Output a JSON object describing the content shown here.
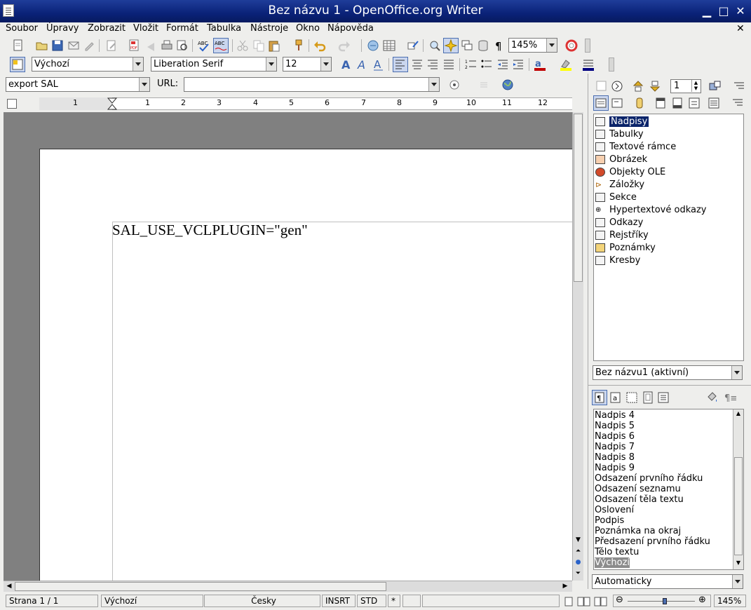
{
  "window": {
    "title": "Bez názvu 1 - OpenOffice.org Writer"
  },
  "menu": {
    "items": [
      "Soubor",
      "Úpravy",
      "Zobrazit",
      "Vložit",
      "Formát",
      "Tabulka",
      "Nástroje",
      "Okno",
      "Nápověda"
    ]
  },
  "toolbar": {
    "zoom": "145%"
  },
  "formatting": {
    "paragraph_style": "Výchozí",
    "font_name": "Liberation Serif",
    "font_size": "12"
  },
  "hyperlink_bar": {
    "target": "export SAL",
    "url_label": "URL:",
    "url_value": ""
  },
  "ruler": {
    "marks": [
      "1",
      "1",
      "2",
      "3",
      "4",
      "5",
      "6",
      "7",
      "8",
      "9",
      "10",
      "11",
      "12"
    ]
  },
  "document": {
    "text": "SAL_USE_VCLPLUGIN=\"gen\""
  },
  "navigator": {
    "page_number": "1",
    "categories": [
      "Nadpisy",
      "Tabulky",
      "Textové rámce",
      "Obrázek",
      "Objekty OLE",
      "Záložky",
      "Sekce",
      "Hypertextové odkazy",
      "Odkazy",
      "Rejstříky",
      "Poznámky",
      "Kresby"
    ],
    "selected": "Nadpisy",
    "document_select": "Bez názvu1 (aktivní)"
  },
  "styles": {
    "items": [
      "Nadpis 4",
      "Nadpis 5",
      "Nadpis 6",
      "Nadpis 7",
      "Nadpis 8",
      "Nadpis 9",
      "Odsazení prvního řádku",
      "Odsazení seznamu",
      "Odsazení těla textu",
      "Oslovení",
      "Podpis",
      "Poznámka na okraj",
      "Předsazení prvního řádku",
      "Tělo textu",
      "Výchozí"
    ],
    "selected": "Výchozí",
    "filter": "Automaticky"
  },
  "statusbar": {
    "page": "Strana 1 / 1",
    "style": "Výchozí",
    "language": "Česky",
    "insert_mode": "INSRT",
    "selection_mode": "STD",
    "modified": "*",
    "zoom": "145%"
  }
}
